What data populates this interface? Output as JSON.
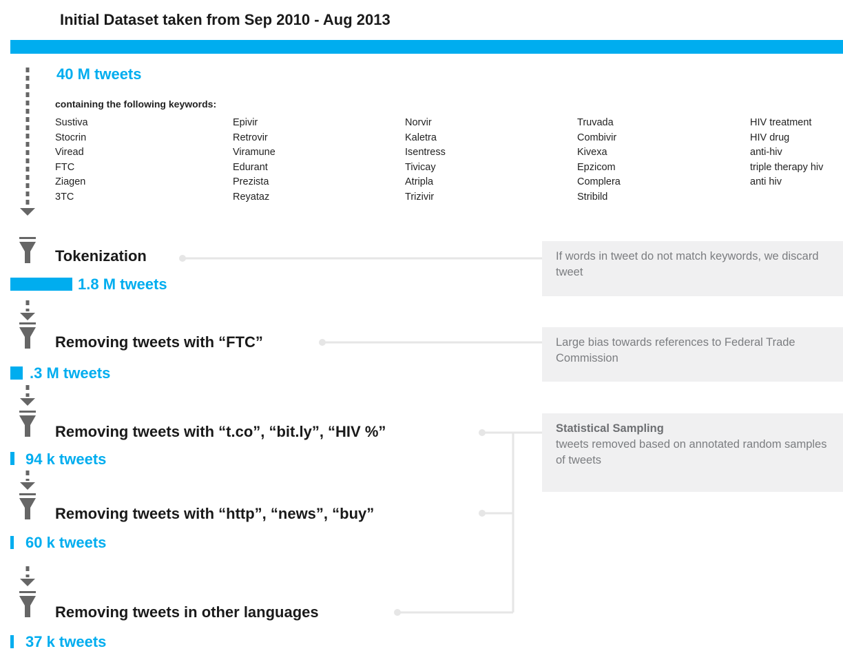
{
  "title": "Initial Dataset taken from  Sep 2010 - Aug 2013",
  "initial": {
    "count": "40 M tweets",
    "keywords_label": "containing the following keywords:",
    "keyword_columns": [
      [
        "Sustiva",
        "Stocrin",
        "Viread",
        "FTC",
        "Ziagen",
        "3TC"
      ],
      [
        "Epivir",
        "Retrovir",
        "Viramune",
        "Edurant",
        "Prezista",
        "Reyataz"
      ],
      [
        "Norvir",
        "Kaletra",
        "Isentress",
        "Tivicay",
        "Atripla",
        "Trizivir"
      ],
      [
        "Truvada",
        "Combivir",
        "Kivexa",
        "Epzicom",
        "Complera",
        "Stribild"
      ],
      [
        "HIV treatment",
        "HIV drug",
        "anti-hiv",
        "triple therapy hiv",
        "anti hiv"
      ]
    ]
  },
  "steps": [
    {
      "label": "Tokenization",
      "result": "1.8 M tweets",
      "tweets_m": 1.8
    },
    {
      "label": "Removing tweets with “FTC”",
      "result": ".3 M tweets",
      "tweets_m": 0.3
    },
    {
      "label": "Removing tweets with “t.co”, “bit.ly”, “HIV %”",
      "result": "94 k tweets",
      "tweets_m": 0.094
    },
    {
      "label": "Removing tweets with “http”, “news”, “buy”",
      "result": "60 k tweets",
      "tweets_m": 0.06
    },
    {
      "label": "Removing tweets in other languages",
      "result": "37 k tweets",
      "tweets_m": 0.037
    }
  ],
  "notes": [
    {
      "text": "If words in tweet do not match keywords, we discard tweet"
    },
    {
      "text": "Large bias towards references to Federal Trade Commission"
    },
    {
      "heading": "Statistical Sampling",
      "text": "tweets removed based on annotated random samples of tweets"
    }
  ],
  "colors": {
    "accent": "#00adef",
    "icon": "#666666",
    "connector": "#e6e6e6",
    "note_bg": "#f0f0f1",
    "note_text": "#7b7d80"
  }
}
